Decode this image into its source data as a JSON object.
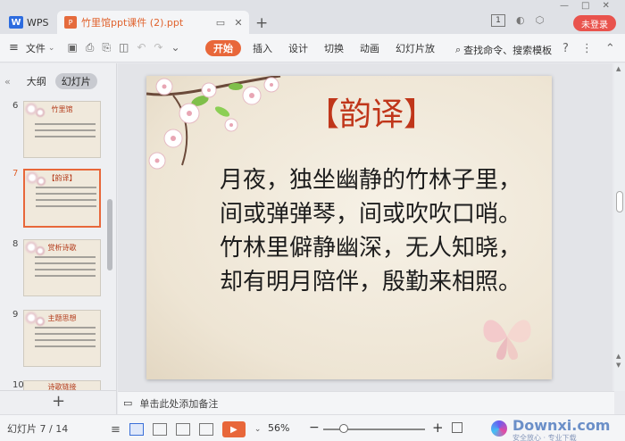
{
  "titlebar": {
    "app_tab": "WPS",
    "doc_tab": "竹里馆ppt课件 (2).ppt",
    "login_button": "未登录",
    "badge": "1"
  },
  "ribbon": {
    "file_menu": "文件",
    "tabs": [
      "开始",
      "插入",
      "设计",
      "切换",
      "动画",
      "幻灯片放"
    ],
    "active_tab": "开始",
    "search_label": "查找命令、搜索模板"
  },
  "left_panel": {
    "tabs": [
      "大纲",
      "幻灯片"
    ],
    "active_tab": "幻灯片",
    "thumbnails": [
      {
        "num": "6",
        "title": "竹里馆",
        "active": false
      },
      {
        "num": "7",
        "title": "【韵译】",
        "active": true
      },
      {
        "num": "8",
        "title": "赏析诗歌",
        "active": false
      },
      {
        "num": "9",
        "title": "主题思想",
        "active": false
      },
      {
        "num": "10",
        "title": "诗歌链接",
        "active": false
      }
    ]
  },
  "slide": {
    "title": "【韵译】",
    "lines": [
      "月夜，独坐幽静的竹林子里，",
      "间或弹弹琴，间或吹吹口哨。",
      "竹林里僻静幽深，无人知晓，",
      "却有明月陪伴，殷勤来相照。"
    ]
  },
  "notes": {
    "placeholder": "单击此处添加备注"
  },
  "statusbar": {
    "slide_count": "幻灯片 7 / 14",
    "zoom": "56%",
    "zoom_level": 0.2,
    "watermark": "Downxi.com",
    "watermark_sub": "安全放心 · 专业下载"
  },
  "colors": {
    "accent": "#e8673a",
    "title_red": "#c0361a",
    "login": "#e9534d"
  }
}
